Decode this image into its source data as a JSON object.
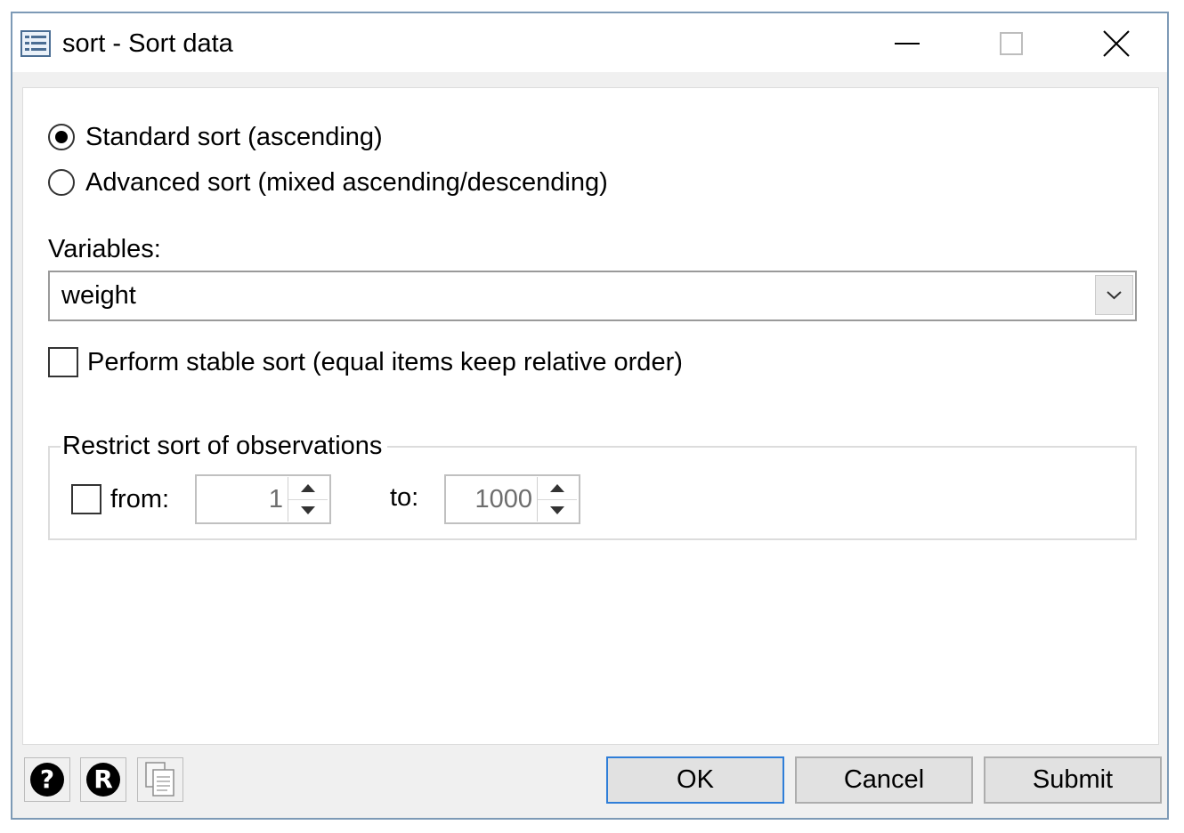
{
  "window": {
    "title": "sort - Sort data",
    "controls": [
      "minimize",
      "maximize",
      "close"
    ]
  },
  "sort_mode": {
    "options": [
      {
        "label": "Standard sort (ascending)",
        "selected": true
      },
      {
        "label": "Advanced sort (mixed ascending/descending)",
        "selected": false
      }
    ]
  },
  "variables": {
    "label": "Variables:",
    "value": "weight"
  },
  "stable_sort": {
    "label": "Perform stable sort (equal items keep relative order)",
    "checked": false
  },
  "restrict": {
    "group_label": "Restrict sort of observations",
    "from_label": "from:",
    "from_checked": false,
    "from_value": "1",
    "to_label": "to:",
    "to_value": "1000"
  },
  "footer": {
    "help_icon_label": "?",
    "reset_icon_label": "R",
    "copy_icon": "copy-command-icon",
    "ok_label": "OK",
    "cancel_label": "Cancel",
    "submit_label": "Submit"
  }
}
